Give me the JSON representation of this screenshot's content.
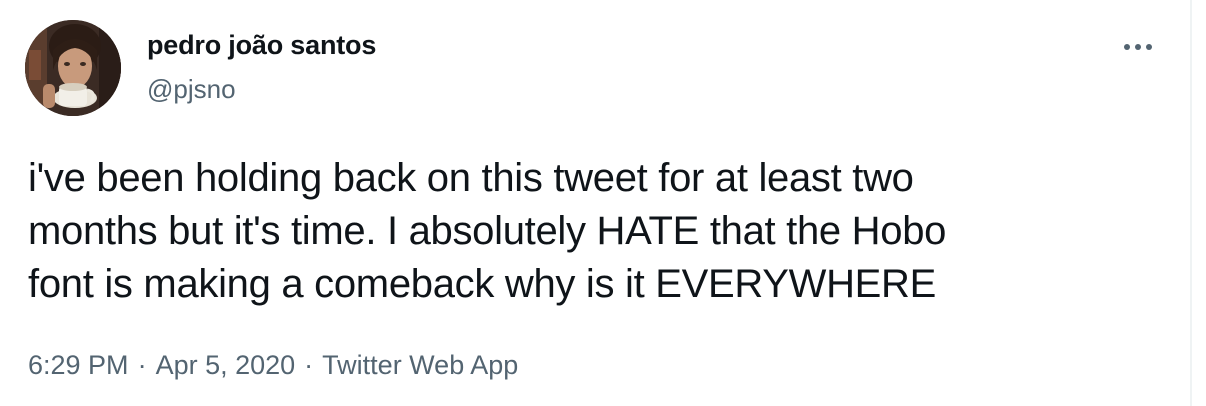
{
  "author": {
    "display_name": "pedro joão santos",
    "handle": "@pjsno"
  },
  "more_icon": "more-horizontal-icon",
  "tweet": {
    "text": "i've been holding back on this tweet for at least two\nmonths but it's time. I absolutely HATE that the Hobo\nfont is making a comeback why is it EVERYWHERE"
  },
  "meta": {
    "time": "6:29 PM",
    "date": "Apr 5, 2020",
    "separator": "·",
    "source": "Twitter Web App"
  },
  "colors": {
    "text_primary": "#0f1419",
    "text_secondary": "#536471",
    "border": "#eff3f4"
  }
}
